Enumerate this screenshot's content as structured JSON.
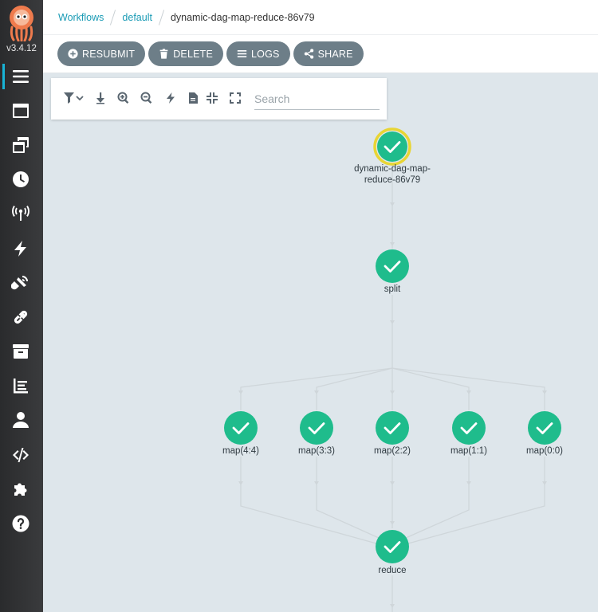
{
  "sidebar": {
    "version": "v3.4.12",
    "items": [
      {
        "icon": "list-icon",
        "label": "Workflows"
      },
      {
        "icon": "window-icon",
        "label": "Workflow Templates"
      },
      {
        "icon": "cluster-templates-icon",
        "label": "Cluster Workflow Templates"
      },
      {
        "icon": "clock-icon",
        "label": "Cron Workflows"
      },
      {
        "icon": "broadcast-icon",
        "label": "Event Sources"
      },
      {
        "icon": "bolt-icon",
        "label": "Sensors"
      },
      {
        "icon": "satellite-icon",
        "label": "Event Flow"
      },
      {
        "icon": "link-icon",
        "label": "Event Bus"
      },
      {
        "icon": "archive-icon",
        "label": "Archived Workflows"
      },
      {
        "icon": "chart-icon",
        "label": "Reports"
      },
      {
        "icon": "user-icon",
        "label": "User"
      },
      {
        "icon": "code-icon",
        "label": "API Docs"
      },
      {
        "icon": "puzzle-icon",
        "label": "Plugins"
      },
      {
        "icon": "help-icon",
        "label": "Help"
      }
    ]
  },
  "breadcrumb": {
    "workflows": "Workflows",
    "namespace": "default",
    "current": "dynamic-dag-map-reduce-86v79"
  },
  "actions": {
    "resubmit": "RESUBMIT",
    "delete": "DELETE",
    "logs": "LOGS",
    "share": "SHARE"
  },
  "toolbar": {
    "search_placeholder": "Search"
  },
  "graph": {
    "root": {
      "line1": "dynamic-dag-map-",
      "line2": "reduce-86v79",
      "status": "succeeded"
    },
    "split": {
      "label": "split",
      "status": "succeeded"
    },
    "maps": [
      {
        "label": "map(4:4)",
        "status": "succeeded"
      },
      {
        "label": "map(3:3)",
        "status": "succeeded"
      },
      {
        "label": "map(2:2)",
        "status": "succeeded"
      },
      {
        "label": "map(1:1)",
        "status": "succeeded"
      },
      {
        "label": "map(0:0)",
        "status": "succeeded"
      }
    ],
    "reduce": {
      "label": "reduce",
      "status": "succeeded"
    }
  },
  "colors": {
    "success": "#1fbc8c",
    "selected_ring": "#e8d534",
    "edge": "#cfd6da",
    "link": "#1a9bb5"
  }
}
